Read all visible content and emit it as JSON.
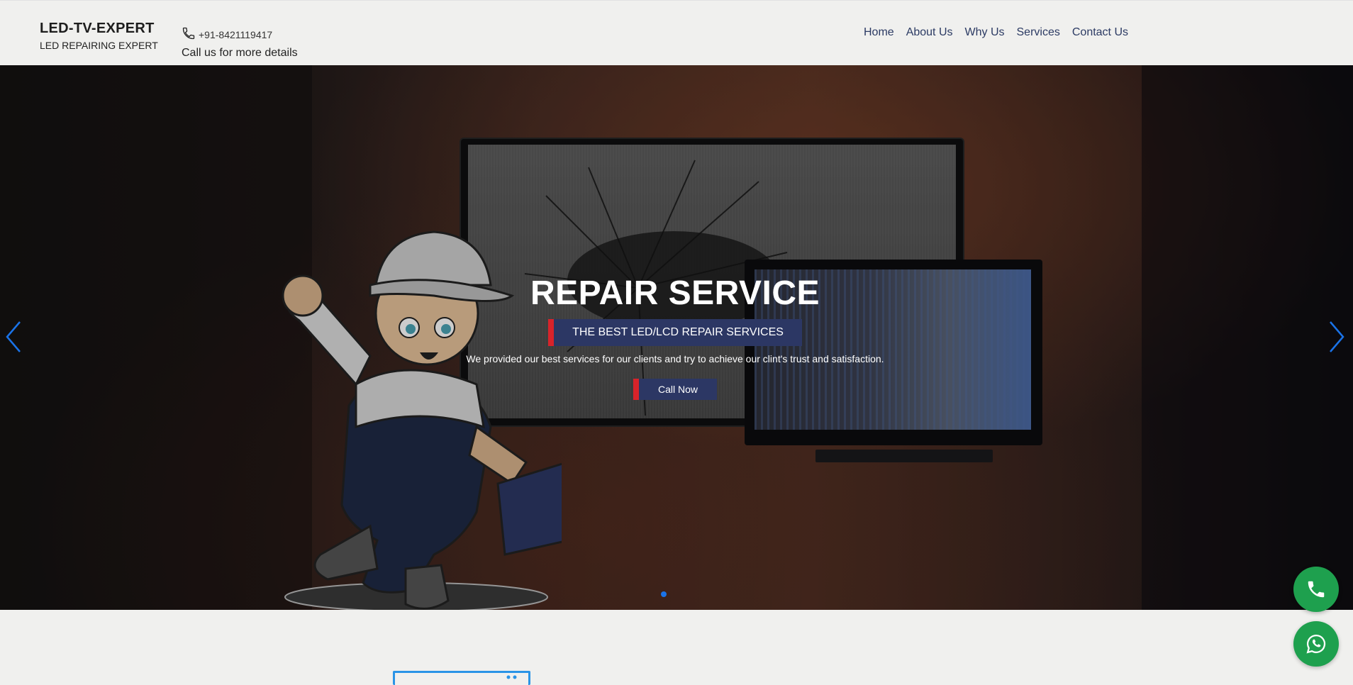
{
  "brand": {
    "title": "LED-TV-EXPERT",
    "subtitle": "LED REPAIRING EXPERT"
  },
  "contact": {
    "phone": "+91-8421119417",
    "note": "Call us for more details",
    "phone_icon": "phone-icon"
  },
  "nav": {
    "items": [
      {
        "label": "Home"
      },
      {
        "label": "About Us"
      },
      {
        "label": "Why Us"
      },
      {
        "label": "Services"
      },
      {
        "label": "Contact Us"
      }
    ]
  },
  "hero": {
    "title": "REPAIR SERVICE",
    "tagline": "THE BEST LED/LCD REPAIR SERVICES",
    "description": "We provided our best services for our clients and try to achieve our clint's trust and satisfaction.",
    "button": "Call Now",
    "prev_icon": "chevron-left-icon",
    "next_icon": "chevron-right-icon",
    "active_slide": 1,
    "slide_count": 1
  },
  "floating": {
    "phone_icon": "phone-icon",
    "whatsapp_icon": "whatsapp-icon"
  },
  "colors": {
    "accent": "#d8232a",
    "navy": "#2c3764",
    "link": "#2b3a63",
    "fab": "#1ea04e",
    "dot": "#1a73e8"
  }
}
